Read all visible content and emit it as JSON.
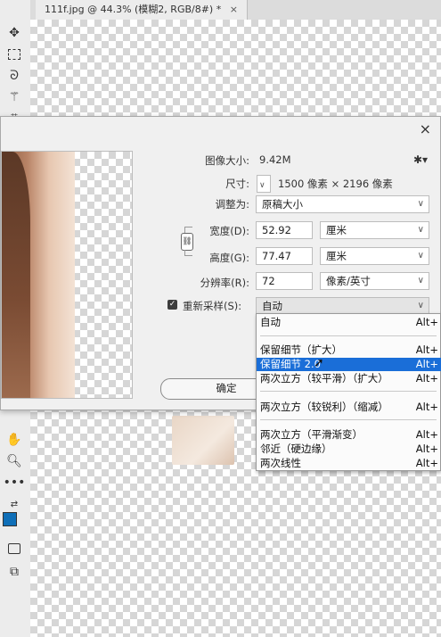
{
  "document_tab": {
    "title": "111f.jpg @ 44.3% (模糊2, RGB/8#) *",
    "close": "×"
  },
  "toolbar": {
    "icons": [
      "move-icon",
      "marquee-icon",
      "lasso-icon",
      "magic-wand-icon",
      "crop-icon",
      "hand-icon",
      "zoom-icon",
      "more-icon",
      "swap-colors-icon",
      "quick-mask-icon",
      "screen-mode-icon"
    ]
  },
  "dialog": {
    "close": "×",
    "image_size_label": "图像大小:",
    "image_size_value": "9.42M",
    "dimensions_label": "尺寸:",
    "dimensions_value": "1500 像素 × 2196 像素",
    "fit_to_label": "调整为:",
    "fit_to_value": "原稿大小",
    "width_label": "宽度(D):",
    "width_value": "52.92",
    "width_unit": "厘米",
    "height_label": "高度(G):",
    "height_value": "77.47",
    "height_unit": "厘米",
    "resolution_label": "分辨率(R):",
    "resolution_value": "72",
    "resolution_unit": "像素/英寸",
    "resample_label": "重新采样(S):",
    "resample_value": "自动",
    "ok_label": "确定"
  },
  "dropdown": {
    "options": [
      {
        "label": "自动",
        "shortcut": "Alt+"
      },
      {
        "label": "保留细节（扩大）",
        "shortcut": "Alt+"
      },
      {
        "label": "保留细节 2.0",
        "shortcut": "Alt+"
      },
      {
        "label": "两次立方（较平滑）（扩大）",
        "shortcut": "Alt+"
      },
      {
        "label": "两次立方（较锐利）（缩减）",
        "shortcut": "Alt+"
      },
      {
        "label": "两次立方（平滑渐变）",
        "shortcut": "Alt+"
      },
      {
        "label": "邻近（硬边缘）",
        "shortcut": "Alt+"
      },
      {
        "label": "两次线性",
        "shortcut": "Alt+"
      }
    ]
  },
  "colors": {
    "selection": "#1a6ed8",
    "foreground": "#0f6fb8",
    "background": "#ffffff"
  }
}
